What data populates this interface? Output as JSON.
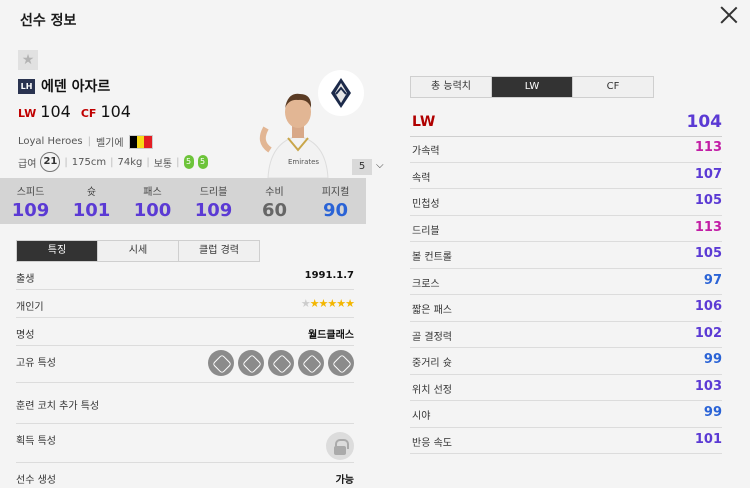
{
  "window": {
    "title": "선수 정보"
  },
  "player": {
    "season": "LH",
    "name": "에덴 아자르",
    "positions": [
      {
        "pos": "LW",
        "ovr": "104"
      },
      {
        "pos": "CF",
        "ovr": "104"
      }
    ],
    "season_name": "Loyal Heroes",
    "nation": "벨기에",
    "salary_label": "급여",
    "salary": "21",
    "height": "175cm",
    "weight": "74kg",
    "body": "보통",
    "left_foot": "5",
    "right_foot": "5",
    "level": "5"
  },
  "stats": [
    {
      "label": "스피드",
      "value": "109",
      "color": "#5b3ad4"
    },
    {
      "label": "슛",
      "value": "101",
      "color": "#5b3ad4"
    },
    {
      "label": "패스",
      "value": "100",
      "color": "#5b3ad4"
    },
    {
      "label": "드리블",
      "value": "109",
      "color": "#5b3ad4"
    },
    {
      "label": "수비",
      "value": "60",
      "color": "#666666"
    },
    {
      "label": "피지컬",
      "value": "90",
      "color": "#2a63d6"
    }
  ],
  "left_tabs": [
    "특징",
    "시세",
    "클럽 경력"
  ],
  "details": {
    "birth_label": "출생",
    "birth": "1991.1.7",
    "popularity_label": "개인기",
    "popularity_stars": 5,
    "popularity_max": 6,
    "fame_label": "명성",
    "fame": "월드클래스",
    "traits_label": "고유 특성",
    "coach_label": "훈련 코치 추가 특성",
    "acquire_label": "획득 특성",
    "create_label": "선수 생성",
    "create": "가능"
  },
  "right_tabs": [
    "총 능력치",
    "LW",
    "CF"
  ],
  "attributes": {
    "header": {
      "name": "LW",
      "value": "104"
    },
    "list": [
      {
        "name": "가속력",
        "value": "113",
        "color": "#c21ea6"
      },
      {
        "name": "속력",
        "value": "107",
        "color": "#5b3ad4"
      },
      {
        "name": "민첩성",
        "value": "105",
        "color": "#5b3ad4"
      },
      {
        "name": "드리블",
        "value": "113",
        "color": "#c21ea6"
      },
      {
        "name": "볼 컨트롤",
        "value": "105",
        "color": "#5b3ad4"
      },
      {
        "name": "크로스",
        "value": "97",
        "color": "#2a63d6"
      },
      {
        "name": "짧은 패스",
        "value": "106",
        "color": "#5b3ad4"
      },
      {
        "name": "골 결정력",
        "value": "102",
        "color": "#5b3ad4"
      },
      {
        "name": "중거리 슛",
        "value": "99",
        "color": "#2a63d6"
      },
      {
        "name": "위치 선정",
        "value": "103",
        "color": "#5b3ad4"
      },
      {
        "name": "시야",
        "value": "99",
        "color": "#2a63d6"
      },
      {
        "name": "반응 속도",
        "value": "101",
        "color": "#5b3ad4"
      }
    ]
  }
}
